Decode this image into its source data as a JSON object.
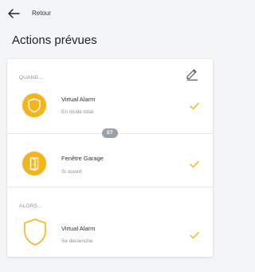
{
  "header": {
    "back_label": "Retour",
    "title": "Actions prévues"
  },
  "card": {
    "when_label": "QUAND...",
    "then_label": "ALORS...",
    "connector": "ET",
    "conditions": [
      {
        "icon": "shield-icon",
        "title": "Virtual Alarm",
        "subtitle": "En mode total"
      },
      {
        "icon": "door-icon",
        "title": "Fenêtre Garage",
        "subtitle": "Si ouvert"
      }
    ],
    "action": {
      "icon": "shield-outline-icon",
      "title": "Virtual Alarm",
      "subtitle": "Se déclenche"
    }
  },
  "colors": {
    "accent": "#f5b31c",
    "background": "#f4f5f7",
    "muted_text": "#8a8f99",
    "badge": "#9aa0a8"
  }
}
